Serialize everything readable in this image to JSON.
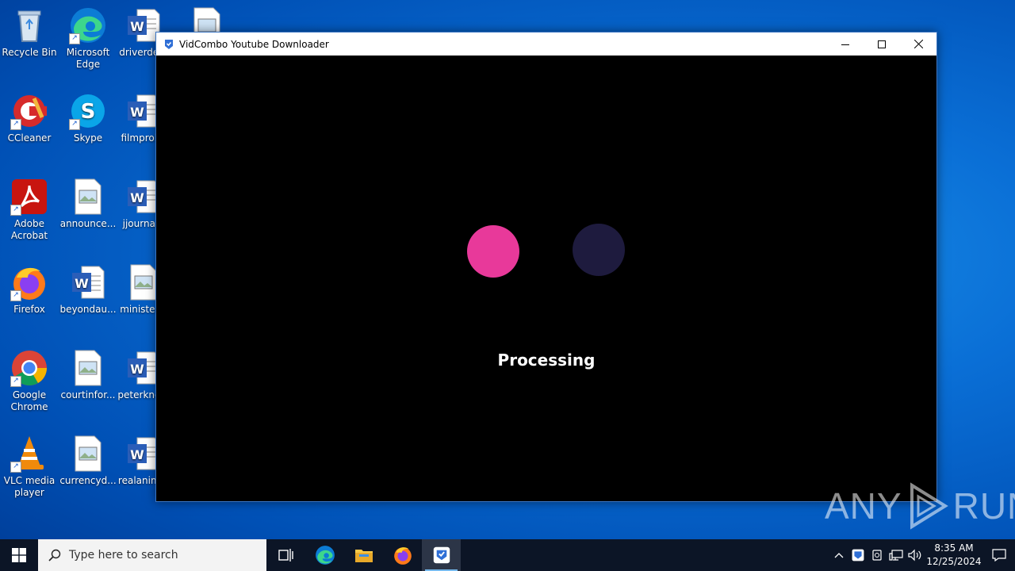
{
  "desktop": {
    "icons": [
      {
        "label": "Recycle Bin"
      },
      {
        "label": "Microsoft Edge"
      },
      {
        "label": "driverde..."
      },
      {
        "label": "CCleaner"
      },
      {
        "label": "Skype"
      },
      {
        "label": "filmprol..."
      },
      {
        "label": "Adobe Acrobat"
      },
      {
        "label": "announce..."
      },
      {
        "label": "jjourna..."
      },
      {
        "label": "Firefox"
      },
      {
        "label": "beyondau..."
      },
      {
        "label": "minister..."
      },
      {
        "label": "Google Chrome"
      },
      {
        "label": "courtinfor..."
      },
      {
        "label": "peterkno..."
      },
      {
        "label": "VLC media player"
      },
      {
        "label": "currencyd..."
      },
      {
        "label": "realanim..."
      }
    ]
  },
  "window": {
    "title": "VidCombo Youtube Downloader",
    "status_text": "Processing",
    "loader_colors": {
      "active": "#e8399a",
      "inactive": "#1e1b3e"
    }
  },
  "taskbar": {
    "search_placeholder": "Type here to search",
    "clock_time": "8:35 AM",
    "clock_date": "12/25/2024"
  },
  "watermark": {
    "text_left": "ANY",
    "text_right": "RUN"
  }
}
